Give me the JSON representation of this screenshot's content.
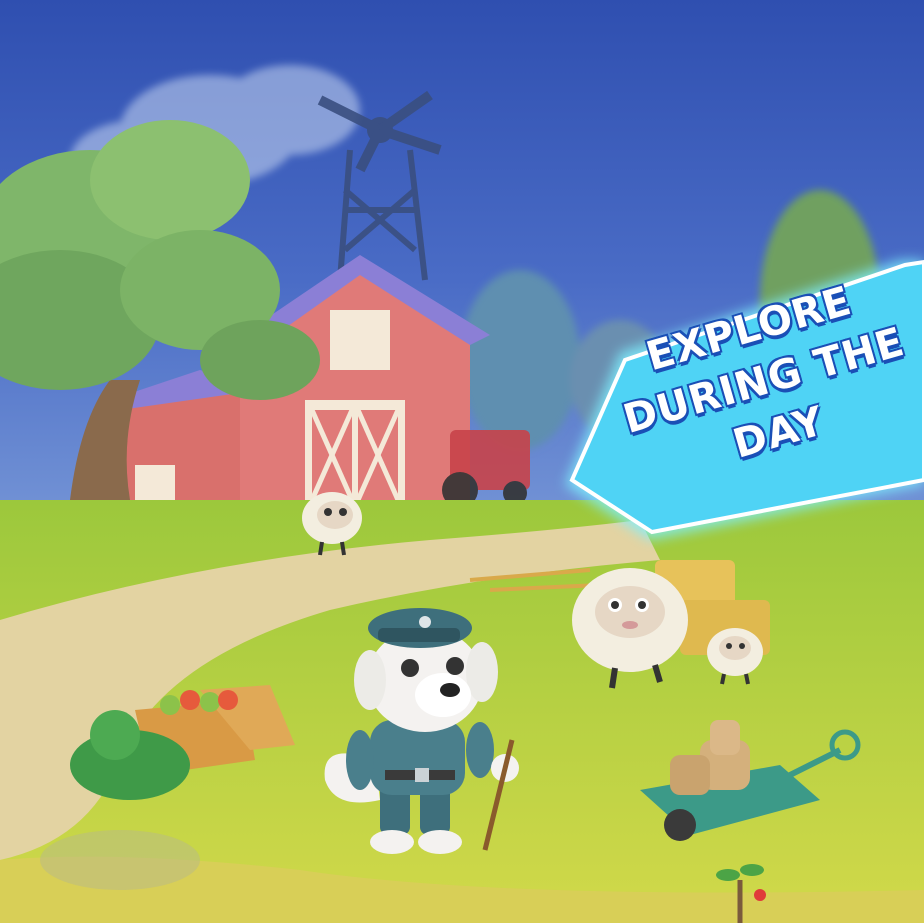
{
  "banner": {
    "line1": "EXPLORE",
    "line2": "DURING THE",
    "line3": "DAY"
  },
  "colors": {
    "sky": "#3a5bb8",
    "grass": "#b9d64a",
    "path": "#e3d3a2",
    "barn": "#e07a78",
    "roof": "#8b7fd6",
    "banner": "#4fd3f5",
    "banner_glow": "#7ff0ff"
  },
  "characters": {
    "dog": "police-dog-character",
    "sheep_count": 3
  }
}
